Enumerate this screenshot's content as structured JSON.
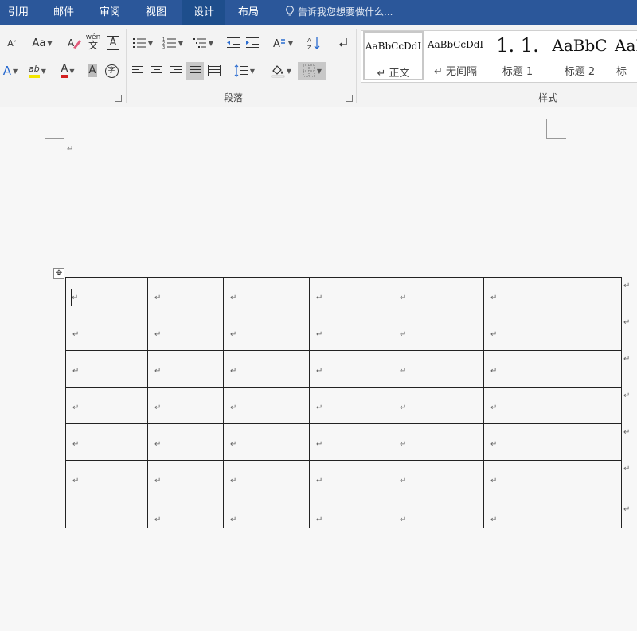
{
  "tabs": [
    {
      "label": "引用",
      "active": false
    },
    {
      "label": "邮件",
      "active": false
    },
    {
      "label": "审阅",
      "active": false
    },
    {
      "label": "视图",
      "active": false
    },
    {
      "label": "设计",
      "active": true
    },
    {
      "label": "布局",
      "active": false
    }
  ],
  "tell_me": "告诉我您想要做什么...",
  "ribbon": {
    "font_group": {
      "change_case": "Aa",
      "grow_font": "A",
      "text_effect": "A",
      "highlight": "ab",
      "font_color": "A",
      "char_shading": "A",
      "enclose": "字",
      "phonetic_top": "wén",
      "phonetic_bottom": "文",
      "char_border": "A"
    },
    "paragraph_group_label": "段落",
    "styles_group_label": "样式",
    "styles": [
      {
        "sample": "AaBbCcDdI",
        "name": "↵ 正文",
        "selected": true
      },
      {
        "sample": "AaBbCcDdI",
        "name": "↵ 无间隔",
        "selected": false
      },
      {
        "sample": "1. 1.",
        "name": "标题 1",
        "selected": false
      },
      {
        "sample": "AaBbC",
        "name": "标题 2",
        "selected": false
      },
      {
        "sample": "AaI",
        "name": "标",
        "selected": false
      }
    ]
  },
  "document": {
    "paragraph_mark": "↵",
    "table": {
      "columns": 6,
      "rows": 7,
      "merged": "first column spans last two rows"
    }
  },
  "colors": {
    "accent": "#2b579a",
    "accent_dark": "#1e4e8c",
    "ribbon_bg": "#f3f3f3",
    "page_bg": "#f7f7f7"
  },
  "icons": [
    "clear-format-icon",
    "phonetic-guide-icon",
    "char-border-icon",
    "bullets-icon",
    "numbering-icon",
    "multilevel-list-icon",
    "decrease-indent-icon",
    "increase-indent-icon",
    "chinese-layout-icon",
    "sort-icon",
    "show-marks-icon",
    "align-left-icon",
    "center-icon",
    "align-right-icon",
    "justify-icon",
    "distributed-icon",
    "line-spacing-icon",
    "shading-icon",
    "borders-icon",
    "table-move-handle-icon"
  ]
}
